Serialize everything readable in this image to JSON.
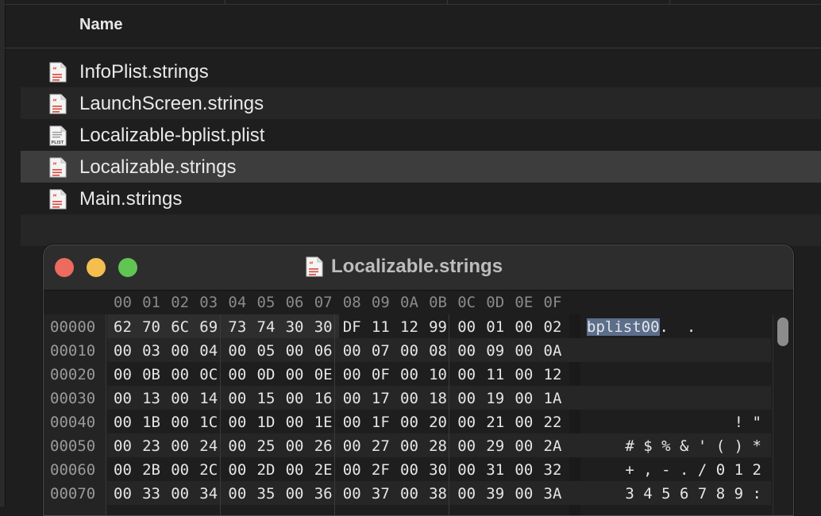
{
  "finder": {
    "column_name": "Name",
    "files": [
      {
        "name": "InfoPlist.strings",
        "icon": "strings-file-icon",
        "state": "normal"
      },
      {
        "name": "LaunchScreen.strings",
        "icon": "strings-file-icon",
        "state": "stripe"
      },
      {
        "name": "Localizable-bplist.plist",
        "icon": "plist-file-icon",
        "state": "normal"
      },
      {
        "name": "Localizable.strings",
        "icon": "strings-file-icon",
        "state": "selected"
      },
      {
        "name": "Main.strings",
        "icon": "strings-file-icon",
        "state": "normal"
      }
    ],
    "plist_icon_label": "PLIST"
  },
  "hex_window": {
    "title": "Localizable.strings",
    "title_icon": "strings-file-icon",
    "traffic_lights": {
      "close": "#ed6a5e",
      "minimize": "#f4bf4f",
      "zoom": "#61c554"
    },
    "column_headers": [
      "00",
      "01",
      "02",
      "03",
      "04",
      "05",
      "06",
      "07",
      "08",
      "09",
      "0A",
      "0B",
      "0C",
      "0D",
      "0E",
      "0F"
    ],
    "rows": [
      {
        "offset": "00000",
        "bytes": [
          "62",
          "70",
          "6C",
          "69",
          "73",
          "74",
          "30",
          "30",
          "DF",
          "11",
          "12",
          "99",
          "00",
          "01",
          "00",
          "02"
        ],
        "ascii_selected": "bplist00",
        "ascii_rest": ".  ."
      },
      {
        "offset": "00010",
        "bytes": [
          "00",
          "03",
          "00",
          "04",
          "00",
          "05",
          "00",
          "06",
          "00",
          "07",
          "00",
          "08",
          "00",
          "09",
          "00",
          "0A"
        ],
        "ascii_selected": "",
        "ascii_rest": ""
      },
      {
        "offset": "00020",
        "bytes": [
          "00",
          "0B",
          "00",
          "0C",
          "00",
          "0D",
          "00",
          "0E",
          "00",
          "0F",
          "00",
          "10",
          "00",
          "11",
          "00",
          "12"
        ],
        "ascii_selected": "",
        "ascii_rest": ""
      },
      {
        "offset": "00030",
        "bytes": [
          "00",
          "13",
          "00",
          "14",
          "00",
          "15",
          "00",
          "16",
          "00",
          "17",
          "00",
          "18",
          "00",
          "19",
          "00",
          "1A"
        ],
        "ascii_selected": "",
        "ascii_rest": ""
      },
      {
        "offset": "00040",
        "bytes": [
          "00",
          "1B",
          "00",
          "1C",
          "00",
          "1D",
          "00",
          "1E",
          "00",
          "1F",
          "00",
          "20",
          "00",
          "21",
          "00",
          "22"
        ],
        "ascii_selected": "",
        "ascii_rest": "      ! \""
      },
      {
        "offset": "00050",
        "bytes": [
          "00",
          "23",
          "00",
          "24",
          "00",
          "25",
          "00",
          "26",
          "00",
          "27",
          "00",
          "28",
          "00",
          "29",
          "00",
          "2A"
        ],
        "ascii_selected": "",
        "ascii_rest": "# $ % & ' ( ) *"
      },
      {
        "offset": "00060",
        "bytes": [
          "00",
          "2B",
          "00",
          "2C",
          "00",
          "2D",
          "00",
          "2E",
          "00",
          "2F",
          "00",
          "30",
          "00",
          "31",
          "00",
          "32"
        ],
        "ascii_selected": "",
        "ascii_rest": "+ , - . / 0 1 2"
      },
      {
        "offset": "00070",
        "bytes": [
          "00",
          "33",
          "00",
          "34",
          "00",
          "35",
          "00",
          "36",
          "00",
          "37",
          "00",
          "38",
          "00",
          "39",
          "00",
          "3A"
        ],
        "ascii_selected": "",
        "ascii_rest": "3 4 5 6 7 8 9 :"
      }
    ],
    "selection_color": "#5b6e8c"
  }
}
